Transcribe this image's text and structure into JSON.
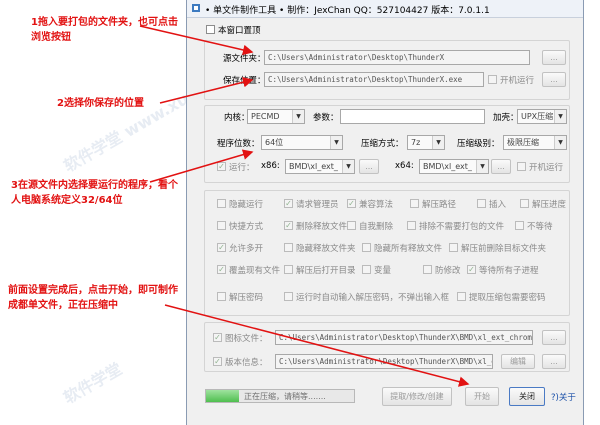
{
  "window": {
    "title": "• 单文件制作工具 • 制作：JexChan  QQ：527104427  版本：7.0.1.1",
    "top_checkbox": "本窗口置顶"
  },
  "paths": {
    "source_label": "源文件夹：",
    "source_value": "C:\\Users\\Administrator\\Desktop\\ThunderX",
    "save_label": "保存位置：",
    "save_value": "C:\\Users\\Administrator\\Desktop\\ThunderX.exe",
    "startup_label": "开机运行",
    "browse": "..."
  },
  "settings": {
    "core_label": "内核：",
    "core_value": "PECMD",
    "param_label": "参数：",
    "shell_label": "加壳：",
    "shell_value": "UPX压缩",
    "bits_label": "程序位数：",
    "bits_value": "64位",
    "compress_label": "压缩方式：",
    "compress_value": "7z",
    "level_label": "压缩级别：",
    "level_value": "极限压缩",
    "run_label": "运行：",
    "x86_label": "x86:",
    "x86_value": "BMD\\xl_ext_",
    "x64_label": "x64:",
    "x64_value": "BMD\\xl_ext_",
    "startup2_label": "开机运行"
  },
  "options": [
    [
      "隐藏运行",
      "请求管理员",
      "兼容算法",
      "解压路径",
      "插入",
      "解压进度"
    ],
    [
      "快捷方式",
      "删除释放文件",
      "自我删除",
      "排除不需要打包的文件",
      "不等待"
    ],
    [
      "允许多开",
      "隐藏释放文件夹",
      "隐藏所有释放文件",
      "解压前删除目标文件夹"
    ],
    [
      "覆盖现有文件",
      "解压后打开目录",
      "变量",
      "防修改",
      "等待所有子进程"
    ],
    [
      "解压密码",
      "运行时自动输入解压密码，不弹出输入框",
      "提取压缩包需要密码"
    ]
  ],
  "bottom": {
    "icon_label": "图标文件：",
    "icon_value": "C:\\Users\\Administrator\\Desktop\\ThunderX\\BMD\\xl_ext_chrom",
    "version_label": "版本信息：",
    "version_value": "C:\\Users\\Administrator\\Desktop\\ThunderX\\BMD\\xl_e",
    "edit_button": "编辑"
  },
  "footer": {
    "progress_text": "正在压缩，请稍等.......",
    "progress_fraction": 0.22,
    "extract_button": "提取/修改/创建",
    "start_button": "开始",
    "close_button": "关闭",
    "about_link": "?)关于"
  },
  "annotations": {
    "a1": "1拖入要打包的文件夹，也可点击浏览按钮",
    "a2": "2选择你保存的位置",
    "a3": "3在源文件内选择要运行的程序，看个人电脑系统定义32/64位",
    "a4": "前面设置完成后，点击开始，即可制作成都单文件，正在压缩中"
  },
  "colors": {
    "annotation": "#e21212",
    "checkmark": "#3a8a3a"
  }
}
